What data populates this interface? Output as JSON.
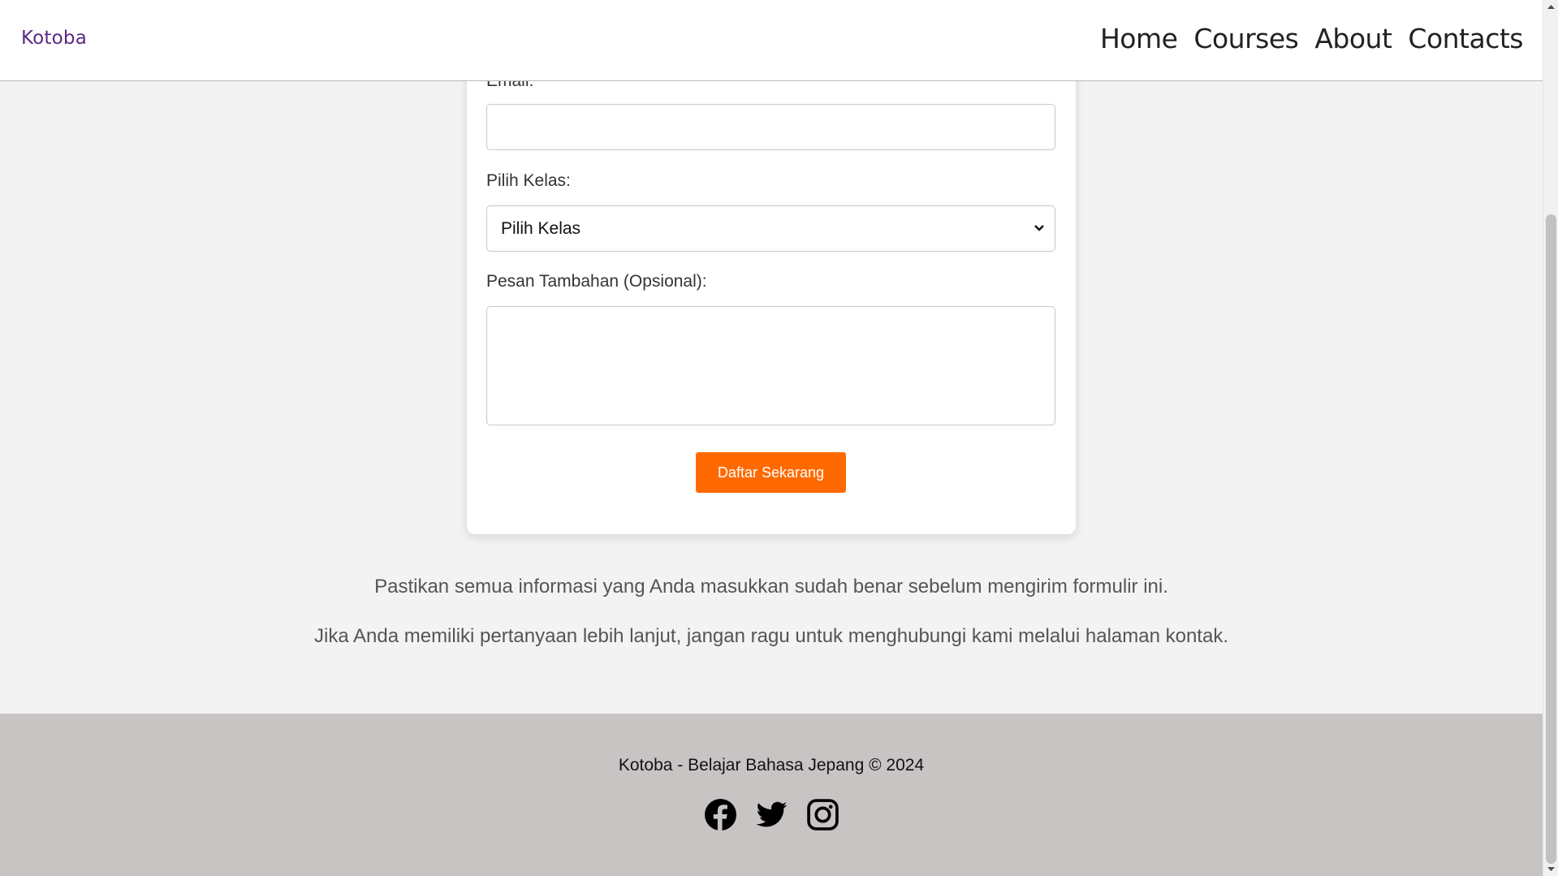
{
  "header": {
    "brand": "Kotoba",
    "nav": [
      "Home",
      "Courses",
      "About",
      "Contacts"
    ]
  },
  "form": {
    "email_label": "Email:",
    "email_value": "",
    "class_label": "Pilih Kelas:",
    "class_selected": "Pilih Kelas",
    "message_label": "Pesan Tambahan (Opsional):",
    "message_value": "",
    "submit_label": "Daftar Sekarang"
  },
  "notes": [
    "Pastikan semua informasi yang Anda masukkan sudah benar sebelum mengirim formulir ini.",
    "Jika Anda memiliki pertanyaan lebih lanjut, jangan ragu untuk menghubungi kami melalui halaman kontak."
  ],
  "footer": {
    "copyright": "Kotoba - Belajar Bahasa Jepang © 2024",
    "social_icons": [
      "facebook-icon",
      "twitter-icon",
      "instagram-icon"
    ]
  },
  "colors": {
    "brand": "#5b2a86",
    "accent": "#ff6a00",
    "footer_bg": "#c9c4c4",
    "page_bg": "#f3f3f3"
  }
}
